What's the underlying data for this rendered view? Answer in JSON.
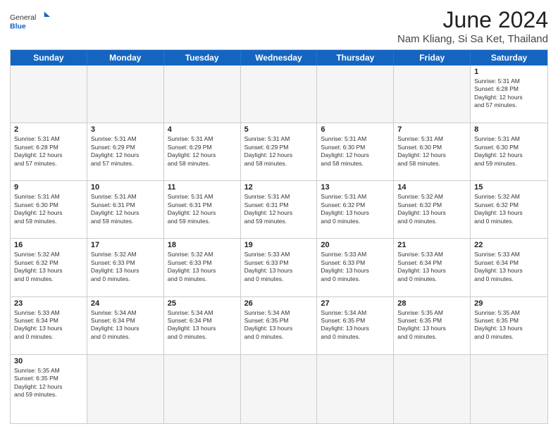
{
  "header": {
    "logo_line1": "General",
    "logo_line2": "Blue",
    "title": "June 2024",
    "subtitle": "Nam Kliang, Si Sa Ket, Thailand"
  },
  "days_of_week": [
    "Sunday",
    "Monday",
    "Tuesday",
    "Wednesday",
    "Thursday",
    "Friday",
    "Saturday"
  ],
  "weeks": [
    [
      {
        "day": "",
        "info": ""
      },
      {
        "day": "",
        "info": ""
      },
      {
        "day": "",
        "info": ""
      },
      {
        "day": "",
        "info": ""
      },
      {
        "day": "",
        "info": ""
      },
      {
        "day": "",
        "info": ""
      },
      {
        "day": "1",
        "info": "Sunrise: 5:31 AM\nSunset: 6:28 PM\nDaylight: 12 hours\nand 57 minutes."
      }
    ],
    [
      {
        "day": "2",
        "info": "Sunrise: 5:31 AM\nSunset: 6:28 PM\nDaylight: 12 hours\nand 57 minutes."
      },
      {
        "day": "3",
        "info": "Sunrise: 5:31 AM\nSunset: 6:29 PM\nDaylight: 12 hours\nand 57 minutes."
      },
      {
        "day": "4",
        "info": "Sunrise: 5:31 AM\nSunset: 6:29 PM\nDaylight: 12 hours\nand 58 minutes."
      },
      {
        "day": "5",
        "info": "Sunrise: 5:31 AM\nSunset: 6:29 PM\nDaylight: 12 hours\nand 58 minutes."
      },
      {
        "day": "6",
        "info": "Sunrise: 5:31 AM\nSunset: 6:30 PM\nDaylight: 12 hours\nand 58 minutes."
      },
      {
        "day": "7",
        "info": "Sunrise: 5:31 AM\nSunset: 6:30 PM\nDaylight: 12 hours\nand 58 minutes."
      },
      {
        "day": "8",
        "info": "Sunrise: 5:31 AM\nSunset: 6:30 PM\nDaylight: 12 hours\nand 59 minutes."
      }
    ],
    [
      {
        "day": "9",
        "info": "Sunrise: 5:31 AM\nSunset: 6:30 PM\nDaylight: 12 hours\nand 59 minutes."
      },
      {
        "day": "10",
        "info": "Sunrise: 5:31 AM\nSunset: 6:31 PM\nDaylight: 12 hours\nand 59 minutes."
      },
      {
        "day": "11",
        "info": "Sunrise: 5:31 AM\nSunset: 6:31 PM\nDaylight: 12 hours\nand 59 minutes."
      },
      {
        "day": "12",
        "info": "Sunrise: 5:31 AM\nSunset: 6:31 PM\nDaylight: 12 hours\nand 59 minutes."
      },
      {
        "day": "13",
        "info": "Sunrise: 5:31 AM\nSunset: 6:32 PM\nDaylight: 13 hours\nand 0 minutes."
      },
      {
        "day": "14",
        "info": "Sunrise: 5:32 AM\nSunset: 6:32 PM\nDaylight: 13 hours\nand 0 minutes."
      },
      {
        "day": "15",
        "info": "Sunrise: 5:32 AM\nSunset: 6:32 PM\nDaylight: 13 hours\nand 0 minutes."
      }
    ],
    [
      {
        "day": "16",
        "info": "Sunrise: 5:32 AM\nSunset: 6:32 PM\nDaylight: 13 hours\nand 0 minutes."
      },
      {
        "day": "17",
        "info": "Sunrise: 5:32 AM\nSunset: 6:33 PM\nDaylight: 13 hours\nand 0 minutes."
      },
      {
        "day": "18",
        "info": "Sunrise: 5:32 AM\nSunset: 6:33 PM\nDaylight: 13 hours\nand 0 minutes."
      },
      {
        "day": "19",
        "info": "Sunrise: 5:33 AM\nSunset: 6:33 PM\nDaylight: 13 hours\nand 0 minutes."
      },
      {
        "day": "20",
        "info": "Sunrise: 5:33 AM\nSunset: 6:33 PM\nDaylight: 13 hours\nand 0 minutes."
      },
      {
        "day": "21",
        "info": "Sunrise: 5:33 AM\nSunset: 6:34 PM\nDaylight: 13 hours\nand 0 minutes."
      },
      {
        "day": "22",
        "info": "Sunrise: 5:33 AM\nSunset: 6:34 PM\nDaylight: 13 hours\nand 0 minutes."
      }
    ],
    [
      {
        "day": "23",
        "info": "Sunrise: 5:33 AM\nSunset: 6:34 PM\nDaylight: 13 hours\nand 0 minutes."
      },
      {
        "day": "24",
        "info": "Sunrise: 5:34 AM\nSunset: 6:34 PM\nDaylight: 13 hours\nand 0 minutes."
      },
      {
        "day": "25",
        "info": "Sunrise: 5:34 AM\nSunset: 6:34 PM\nDaylight: 13 hours\nand 0 minutes."
      },
      {
        "day": "26",
        "info": "Sunrise: 5:34 AM\nSunset: 6:35 PM\nDaylight: 13 hours\nand 0 minutes."
      },
      {
        "day": "27",
        "info": "Sunrise: 5:34 AM\nSunset: 6:35 PM\nDaylight: 13 hours\nand 0 minutes."
      },
      {
        "day": "28",
        "info": "Sunrise: 5:35 AM\nSunset: 6:35 PM\nDaylight: 13 hours\nand 0 minutes."
      },
      {
        "day": "29",
        "info": "Sunrise: 5:35 AM\nSunset: 6:35 PM\nDaylight: 13 hours\nand 0 minutes."
      }
    ],
    [
      {
        "day": "30",
        "info": "Sunrise: 5:35 AM\nSunset: 6:35 PM\nDaylight: 12 hours\nand 59 minutes."
      },
      {
        "day": "",
        "info": ""
      },
      {
        "day": "",
        "info": ""
      },
      {
        "day": "",
        "info": ""
      },
      {
        "day": "",
        "info": ""
      },
      {
        "day": "",
        "info": ""
      },
      {
        "day": "",
        "info": ""
      }
    ]
  ]
}
